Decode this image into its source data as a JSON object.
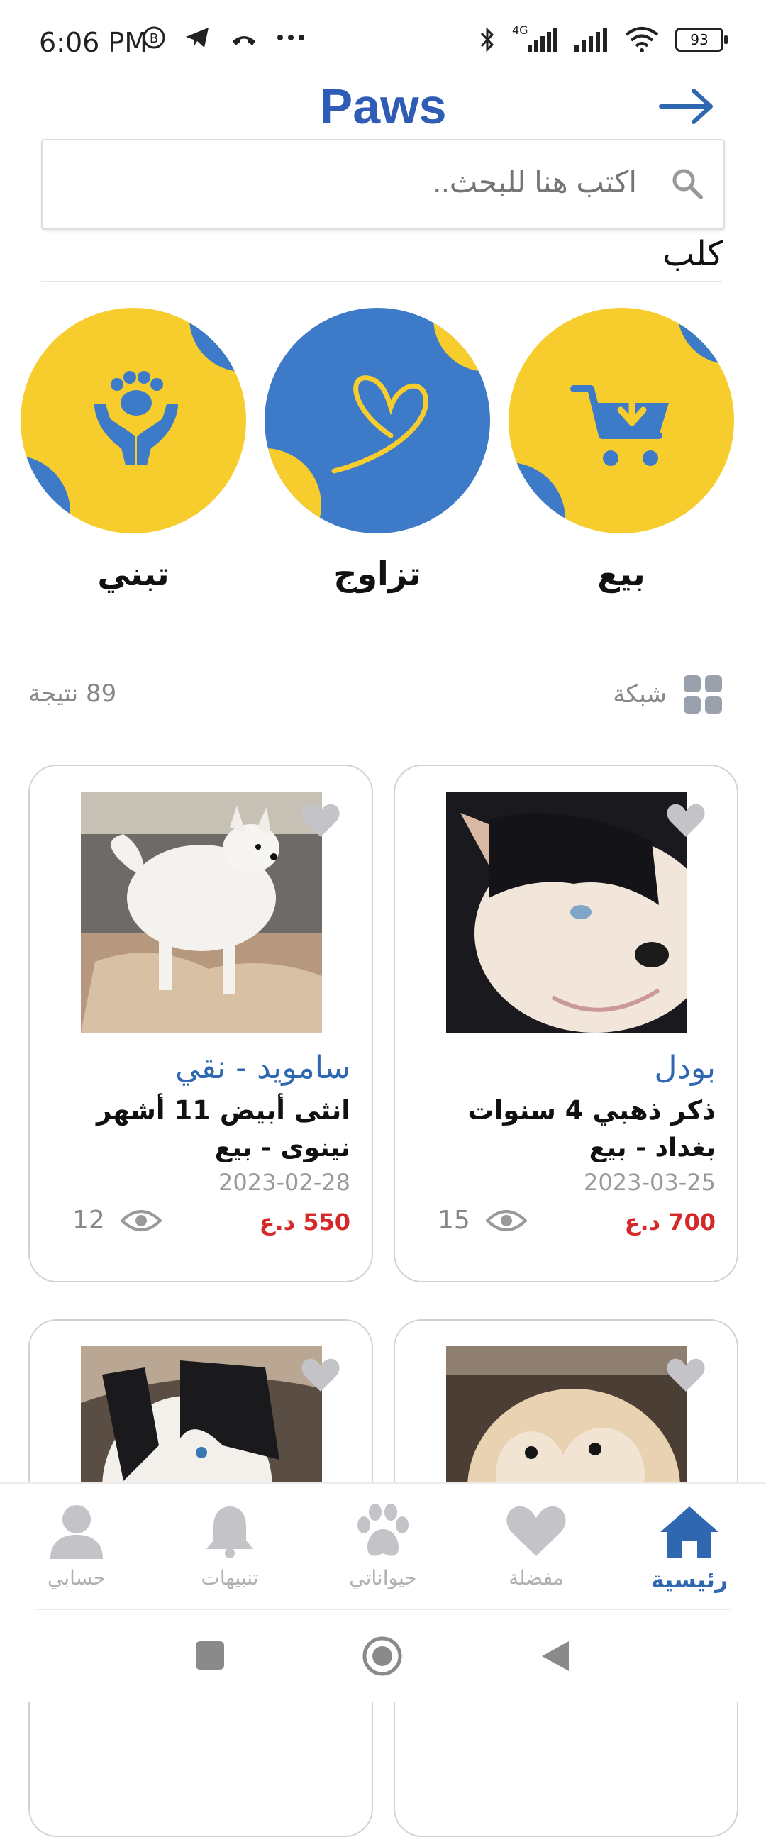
{
  "status_bar": {
    "time": "6:06 PM",
    "network": "4G",
    "battery": "93"
  },
  "app_bar": {
    "title": "Paws"
  },
  "search": {
    "placeholder": "اكتب هنا للبحث.."
  },
  "filter": {
    "selected": "كلب"
  },
  "categories": [
    {
      "label": "بيع",
      "icon": "cart-download-icon"
    },
    {
      "label": "تزاوج",
      "icon": "heart-outline-icon"
    },
    {
      "label": "تبني",
      "icon": "paw-hands-icon"
    }
  ],
  "results": {
    "count_label": "89 نتيجة",
    "view_label": "شبكة"
  },
  "listings": [
    {
      "title": "بودل",
      "desc": "ذكر ذهبي 4 سنوات",
      "location": "بغداد - بيع",
      "date": "2023-03-25",
      "price": "700 د.ع",
      "views": "15"
    },
    {
      "title": "ساموید - نقي",
      "desc": "انثى أبيض 11 أشهر",
      "location": "نينوى - بيع",
      "date": "2023-02-28",
      "price": "550 د.ع",
      "views": "12"
    },
    {
      "title": "",
      "desc": "",
      "location": "",
      "date": "",
      "price": "",
      "views": ""
    },
    {
      "title": "",
      "desc": "",
      "location": "",
      "date": "",
      "price": "",
      "views": ""
    }
  ],
  "bottom_nav": [
    {
      "label": "رئيسية",
      "icon": "home-icon",
      "active": true
    },
    {
      "label": "مفضلة",
      "icon": "heart-icon",
      "active": false
    },
    {
      "label": "حيواناتي",
      "icon": "paw-icon",
      "active": false
    },
    {
      "label": "تنبيهات",
      "icon": "bell-icon",
      "active": false
    },
    {
      "label": "حسابي",
      "icon": "user-icon",
      "active": false
    }
  ],
  "colors": {
    "primary": "#2f68b0",
    "title": "#2f5db5",
    "accent_yellow": "#f6cd2d",
    "accent_blue": "#3d7ac7",
    "price": "#d62828"
  }
}
